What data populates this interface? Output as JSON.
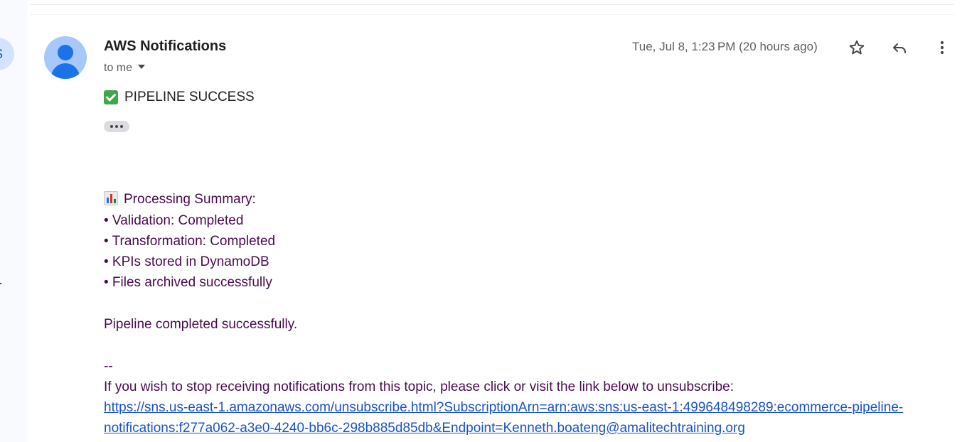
{
  "sidebar": {
    "avatar_letter": "S"
  },
  "message": {
    "sender": "AWS Notifications",
    "recipient": "to me",
    "timestamp": "Tue, Jul 8, 1:23 PM (20 hours ago)",
    "subject": "PIPELINE SUCCESS",
    "summary_heading": "Processing Summary:",
    "summary_items": [
      "• Validation: Completed",
      "• Transformation: Completed",
      "• KPIs stored in DynamoDB",
      "• Files archived successfully"
    ],
    "completion_text": "Pipeline completed successfully.",
    "signature_separator": "--",
    "unsubscribe_text": "If you wish to stop receiving notifications from this topic, please click or visit the link below to unsubscribe:",
    "unsubscribe_link_line1": "https://sns.us-east-1.amazonaws.com/unsubscribe.html?SubscriptionArn=arn:aws:sns:us-east-1:499648498289:ecommerce-pipeline-",
    "unsubscribe_link_line2": "notifications:f277a062-a3e0-4240-bb6c-298b885d85db&Endpoint=Kenneth.boateng@amalitechtraining.org"
  },
  "icons": {
    "star": "star-icon",
    "reply": "reply-icon",
    "more": "more-vert-icon",
    "check": "check-mark-icon",
    "chart": "bar-chart-icon"
  },
  "colors": {
    "body_text": "#4a0a4f",
    "link": "#1a53c7",
    "avatar_bg": "#a8c7fa",
    "avatar_fg": "#1a73e8",
    "check_green": "#3fa64a"
  }
}
